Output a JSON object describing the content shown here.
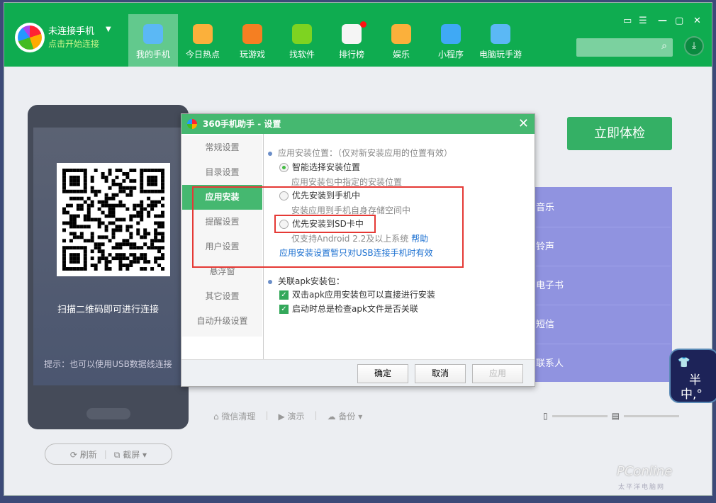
{
  "header": {
    "account_title": "未连接手机",
    "account_subtitle": "点击开始连接",
    "nav": [
      {
        "label": "我的手机",
        "color": "#5bb8f5"
      },
      {
        "label": "今日热点",
        "color": "#fbb03b"
      },
      {
        "label": "玩游戏",
        "color": "#f57f22"
      },
      {
        "label": "找软件",
        "color": "#7ed321"
      },
      {
        "label": "排行榜",
        "color": "#f5f5f5"
      },
      {
        "label": "娱乐",
        "color": "#fbb03b"
      },
      {
        "label": "小程序",
        "color": "#3fa9f5"
      },
      {
        "label": "电脑玩手游",
        "color": "#5bb8f5"
      }
    ],
    "window_controls": [
      "▭",
      "☰",
      "—",
      "▢",
      "✕"
    ],
    "search_icon": "⌕",
    "download_icon": "⤓"
  },
  "phone": {
    "scan_text": "扫描二维码即可进行连接",
    "tip": "提示：也可以使用USB数据线连接",
    "refresh": "⟳ 刷新",
    "screenshot": "⧉ 截屏 ▾"
  },
  "main": {
    "check_button": "立即体检",
    "rows": [
      "音乐",
      "铃声",
      "电子书",
      "短信",
      "联系人"
    ],
    "tools": [
      "⌂ 微信清理",
      "▶ 演示",
      "☁ 备份 ▾"
    ],
    "storage_icons": [
      "▯",
      "▤"
    ]
  },
  "dialog": {
    "title": "360手机助手 - 设置",
    "close": "✕",
    "sidebar": [
      "常规设置",
      "目录设置",
      "应用安装",
      "提醒设置",
      "用户设置",
      "悬浮窗",
      "其它设置",
      "自动升级设置"
    ],
    "install_heading": "应用安装位置：（仅对新安装应用的位置有效）",
    "opt1": "智能选择安装位置",
    "opt1_desc": "应用安装包中指定的安装位置",
    "opt2": "优先安装到手机中",
    "opt2_desc": "安装应用到手机自身存储空间中",
    "opt3": "优先安装到SD卡中",
    "opt3_desc": "仅支持Android 2.2及以上系统",
    "help": "帮助",
    "usb_note": "应用安装设置暂只对USB连接手机时有效",
    "apk_heading": "关联apk安装包：",
    "cb1": "双击apk应用安装包可以直接进行安装",
    "cb2": "启动时总是检查apk文件是否关联",
    "ok": "确定",
    "cancel": "取消",
    "apply": "应用"
  },
  "ime": {
    "line1": "半",
    "line2": "中,°"
  },
  "watermark": {
    "brand": "PConline",
    "sub": "太平洋电脑网"
  }
}
